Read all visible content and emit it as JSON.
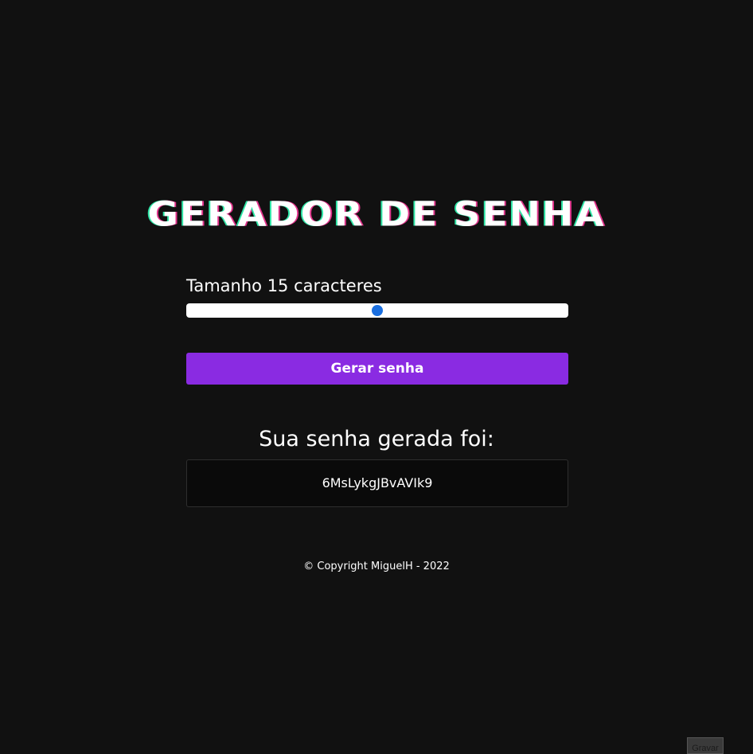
{
  "header": {
    "title": "GERADOR DE SENHA"
  },
  "slider": {
    "label": "Tamanho 15 caracteres",
    "value_fraction": 0.5,
    "thumb_color": "#1a6fe0"
  },
  "actions": {
    "generate_label": "Gerar senha",
    "generate_color": "#8a2be2"
  },
  "result": {
    "heading": "Sua senha gerada foi:",
    "password": "6MsLykgJBvAVIk9"
  },
  "footer": {
    "copyright": "© Copyright MiguelH - 2022"
  },
  "overlay": {
    "record_label": "Gravar"
  }
}
